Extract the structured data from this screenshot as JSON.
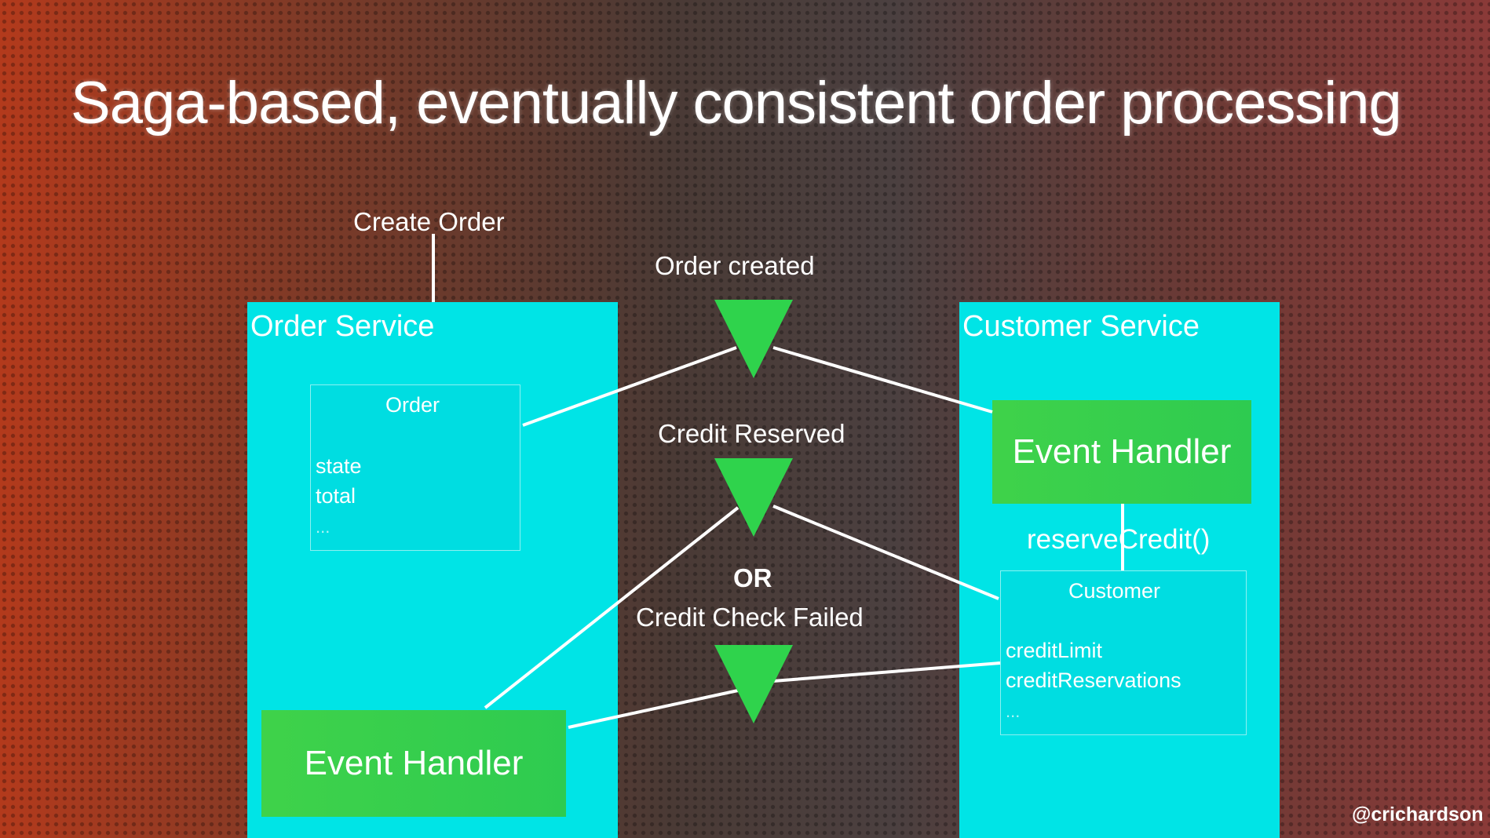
{
  "title": "Saga-based, eventually consistent order processing",
  "create_order": "Create Order",
  "order_service": {
    "title": "Order Service",
    "entity": {
      "name": "Order",
      "fields": [
        "state",
        "total"
      ],
      "ellipsis": "..."
    },
    "handler": "Event Handler"
  },
  "customer_service": {
    "title": "Customer Service",
    "handler": "Event Handler",
    "method": "reserveCredit()",
    "entity": {
      "name": "Customer",
      "fields": [
        "creditLimit",
        "creditReservations"
      ],
      "ellipsis": "..."
    }
  },
  "events": {
    "order_created": "Order created",
    "credit_reserved": "Credit Reserved",
    "or": "OR",
    "credit_check_failed": "Credit Check Failed"
  },
  "handle": "@crichardson",
  "colors": {
    "service_box": "#00e4e6",
    "handler": "#33cc4a",
    "event_triangle": "#2fd34c"
  }
}
